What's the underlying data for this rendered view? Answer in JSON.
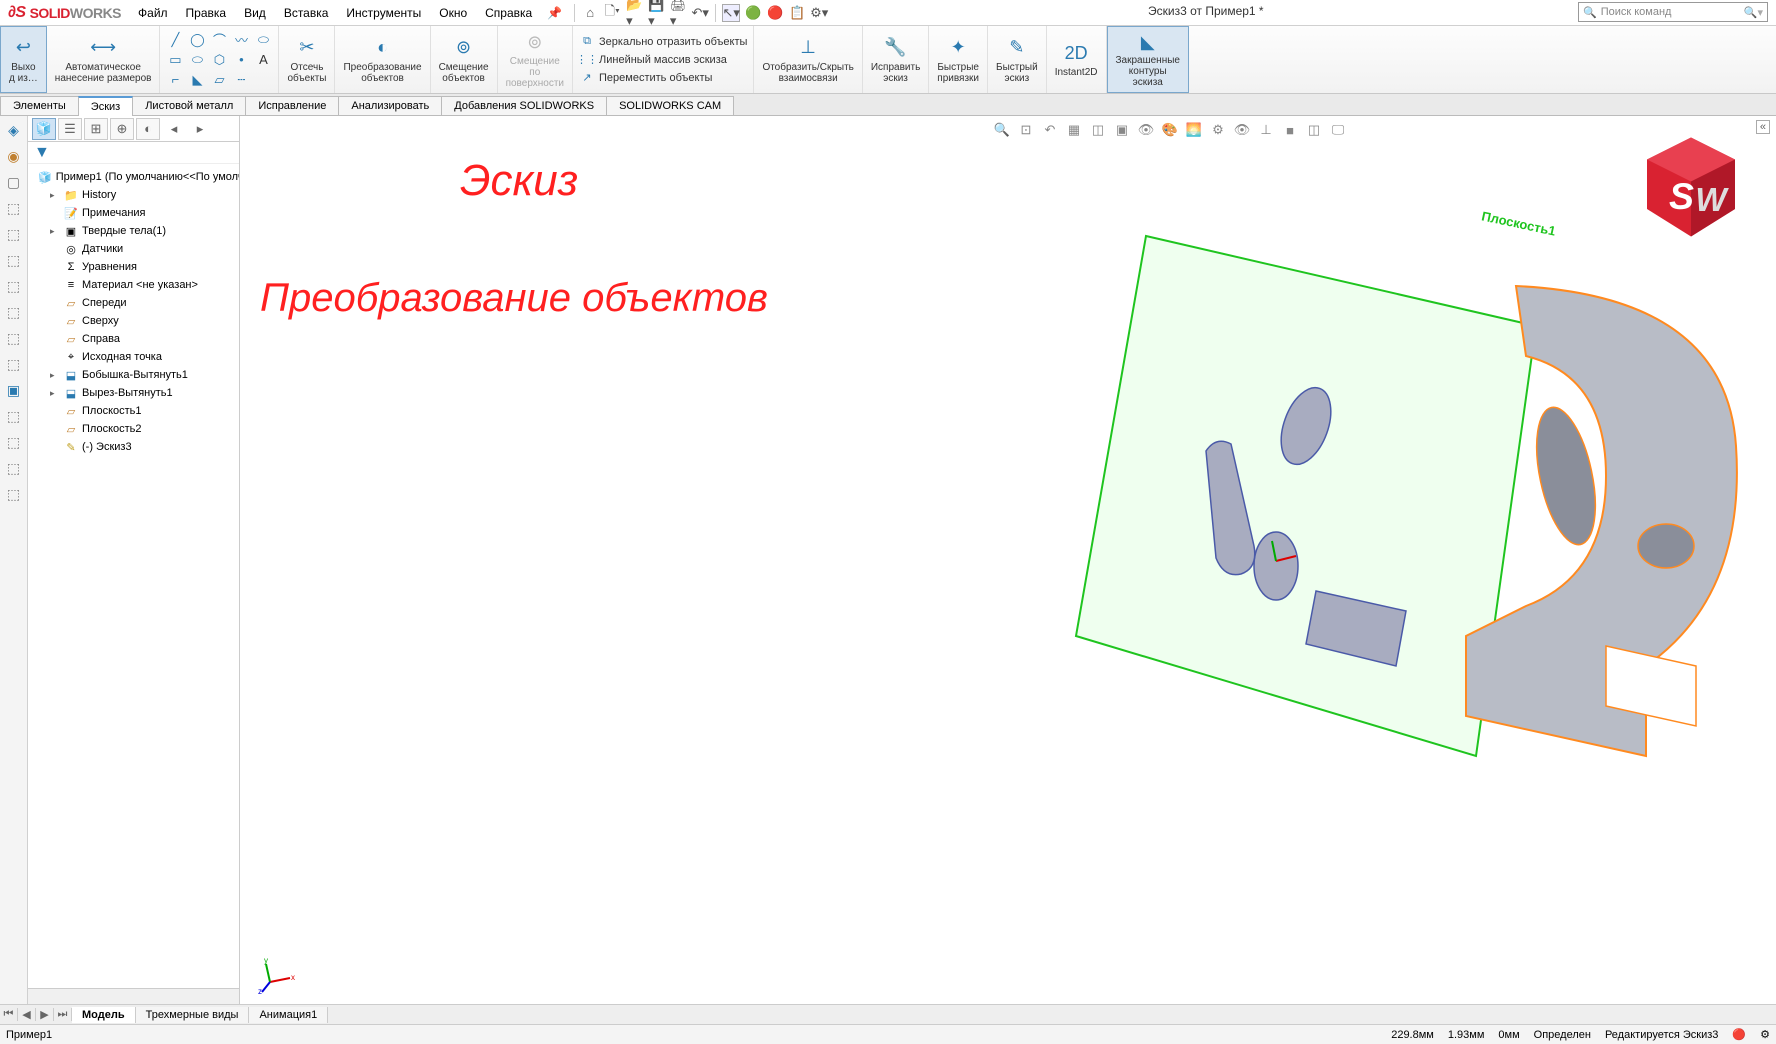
{
  "app": {
    "brand_solid": "SOLID",
    "brand_works": "WORKS",
    "doc_title": "Эскиз3 от Пример1 *",
    "search_placeholder": "Поиск команд"
  },
  "menu": {
    "file": "Файл",
    "edit": "Правка",
    "view": "Вид",
    "insert": "Вставка",
    "tools": "Инструменты",
    "window": "Окно",
    "help": "Справка"
  },
  "ribbon": {
    "exit": "Выхо\nд из…",
    "autodim": "Автоматическое\nнанесение размеров",
    "trim": "Отсечь\nобъекты",
    "convert": "Преобразование\nобъектов",
    "offset": "Смещение\nобъектов",
    "surface_offset": "Смещение\nпо\nповерхности",
    "mirror": "Зеркально отразить объекты",
    "linear_pattern": "Линейный массив эскиза",
    "move": "Переместить объекты",
    "show_hide": "Отобразить/Скрыть\nвзаимосвязи",
    "repair": "Исправить\nэскиз",
    "quick_snaps": "Быстрые\nпривязки",
    "rapid": "Быстрый\nэскиз",
    "instant2d": "Instant2D",
    "shaded": "Закрашенные\nконтуры\nэскиза"
  },
  "tabs": {
    "features": "Элементы",
    "sketch": "Эскиз",
    "sheetmetal": "Листовой металл",
    "evaluate": "Исправление",
    "analyze": "Анализировать",
    "addins": "Добавления SOLIDWORKS",
    "cam": "SOLIDWORKS CAM"
  },
  "tree": {
    "root": "Пример1  (По умолчанию<<По умолч",
    "history": "History",
    "annotations": "Примечания",
    "solid_bodies": "Твердые тела(1)",
    "sensors": "Датчики",
    "equations": "Уравнения",
    "material": "Материал <не указан>",
    "front": "Спереди",
    "top": "Сверху",
    "right": "Справа",
    "origin": "Исходная точка",
    "boss": "Бобышка-Вытянуть1",
    "cut": "Вырез-Вытянуть1",
    "plane1": "Плоскость1",
    "plane2": "Плоскость2",
    "sketch3": "(-) Эскиз3"
  },
  "overlay": {
    "title": "Эскиз",
    "sub": "Преобразование объектов",
    "plane": "Плоскость1"
  },
  "bottom": {
    "model": "Модель",
    "views3d": "Трехмерные виды",
    "anim": "Анимация1"
  },
  "status": {
    "doc": "Пример1",
    "dim1": "229.8мм",
    "dim2": "1.93мм",
    "dim3": "0мм",
    "defined": "Определен",
    "editing": "Редактируется Эскиз3"
  }
}
